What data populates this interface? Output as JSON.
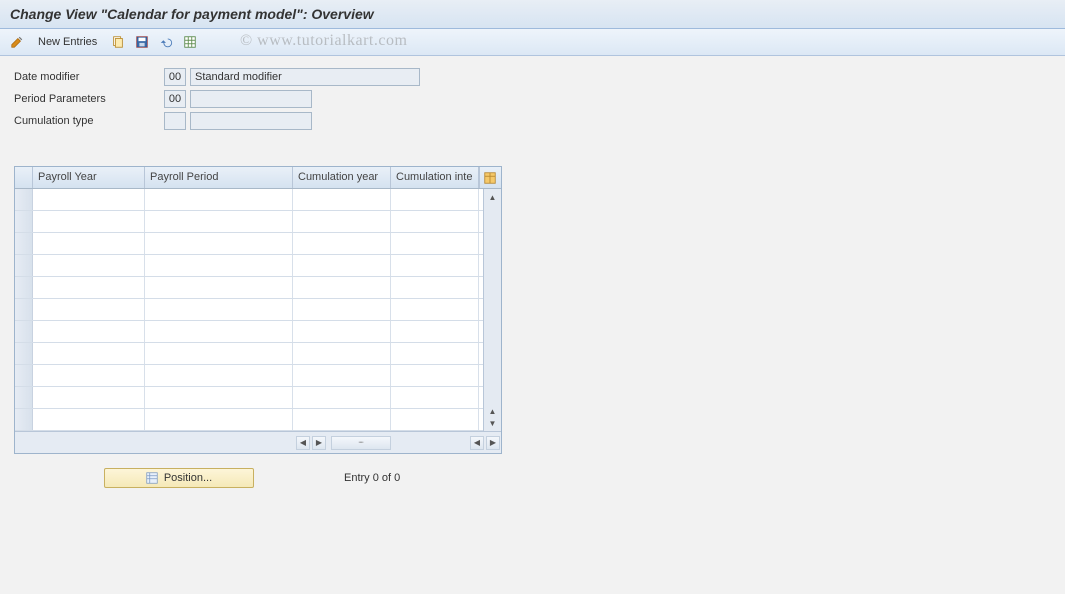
{
  "title": "Change View \"Calendar for payment model\": Overview",
  "toolbar": {
    "new_entries_label": "New Entries"
  },
  "watermark": "© www.tutorialkart.com",
  "form": {
    "date_modifier": {
      "label": "Date modifier",
      "code": "00",
      "desc": "Standard modifier"
    },
    "period_parameters": {
      "label": "Period Parameters",
      "code": "00",
      "desc": ""
    },
    "cumulation_type": {
      "label": "Cumulation type",
      "code": "",
      "desc": ""
    }
  },
  "table": {
    "columns": {
      "c1": "Payroll Year",
      "c2": "Payroll Period",
      "c3": "Cumulation year",
      "c4": "Cumulation inte"
    }
  },
  "footer": {
    "position_btn": "Position...",
    "entry_text": "Entry 0 of 0"
  },
  "chart_data": {
    "type": "table",
    "columns": [
      "Payroll Year",
      "Payroll Period",
      "Cumulation year",
      "Cumulation inte"
    ],
    "rows": []
  }
}
